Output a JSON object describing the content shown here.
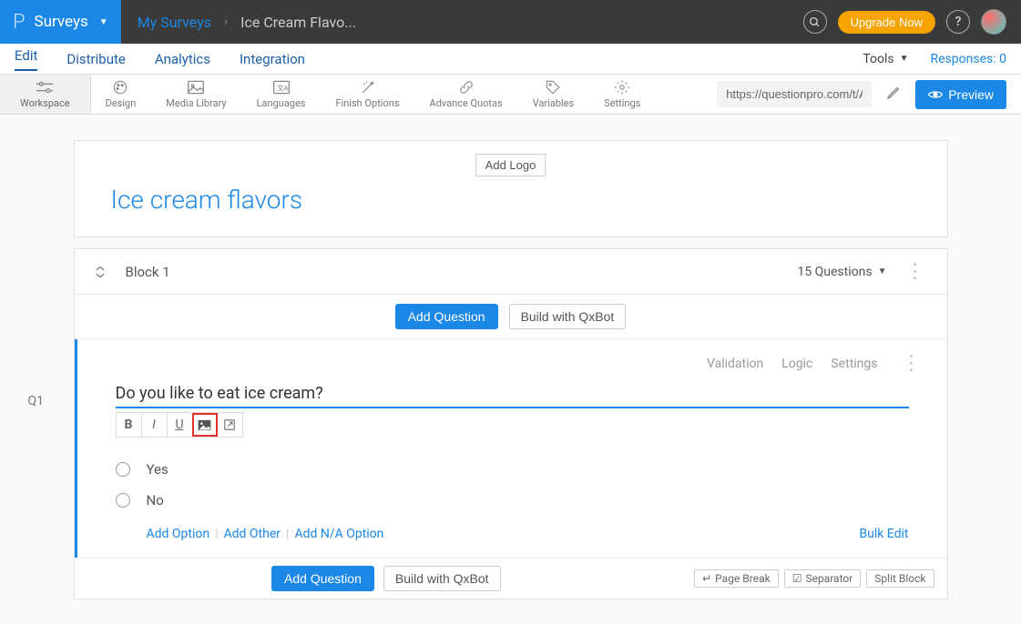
{
  "topbar": {
    "app": "Surveys",
    "breadcrumb_home": "My Surveys",
    "breadcrumb_current": "Ice Cream Flavo...",
    "upgrade": "Upgrade Now"
  },
  "tabs": {
    "edit": "Edit",
    "distribute": "Distribute",
    "analytics": "Analytics",
    "integration": "Integration",
    "tools": "Tools",
    "responses": "Responses: 0"
  },
  "toolbar": {
    "workspace": "Workspace",
    "design": "Design",
    "media": "Media Library",
    "languages": "Languages",
    "finish": "Finish Options",
    "quotas": "Advance Quotas",
    "variables": "Variables",
    "settings": "Settings",
    "url": "https://questionpro.com/t/A",
    "preview": "Preview"
  },
  "survey": {
    "add_logo": "Add Logo",
    "title": "Ice cream flavors"
  },
  "block": {
    "name": "Block 1",
    "count": "15 Questions",
    "add_question": "Add Question",
    "qxbot": "Build with QxBot"
  },
  "question": {
    "number": "Q1",
    "validation": "Validation",
    "logic": "Logic",
    "settings": "Settings",
    "text": "Do you like to eat ice cream?",
    "opt1": "Yes",
    "opt2": "No",
    "add_option": "Add Option",
    "add_other": "Add Other",
    "add_na": "Add N/A Option",
    "bulk_edit": "Bulk Edit"
  },
  "chips": {
    "page_break": "Page Break",
    "separator": "Separator",
    "split": "Split Block"
  }
}
